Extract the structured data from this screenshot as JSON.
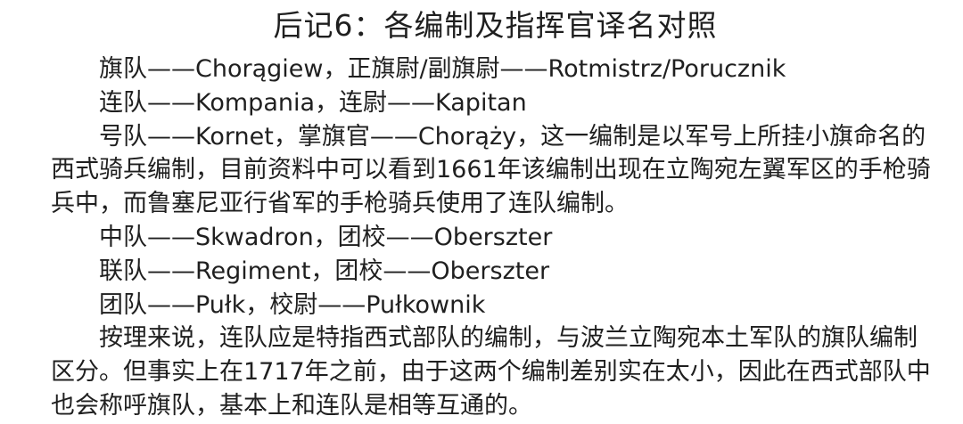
{
  "title": "后记6：各编制及指挥官译名对照",
  "paragraphs": [
    "旗队——Chorągiew，正旗尉/副旗尉——Rotmistrz/Porucznik",
    "连队——Kompania，连尉——Kapitan",
    "号队——Kornet，掌旗官——Chorąży，这一编制是以军号上所挂小旗命名的西式骑兵编制，目前资料中可以看到1661年该编制出现在立陶宛左翼军区的手枪骑兵中，而鲁塞尼亚行省军的手枪骑兵使用了连队编制。",
    "中队——Skwadron，团校——Oberszter",
    "联队——Regiment，团校——Oberszter",
    "团队——Pułk，校尉——Pułkownik",
    "按理来说，连队应是特指西式部队的编制，与波兰立陶宛本土军队的旗队编制区分。但事实上在1717年之前，由于这两个编制差别实在太小，因此在西式部队中也会称呼旗队，基本上和连队是相等互通的。"
  ]
}
